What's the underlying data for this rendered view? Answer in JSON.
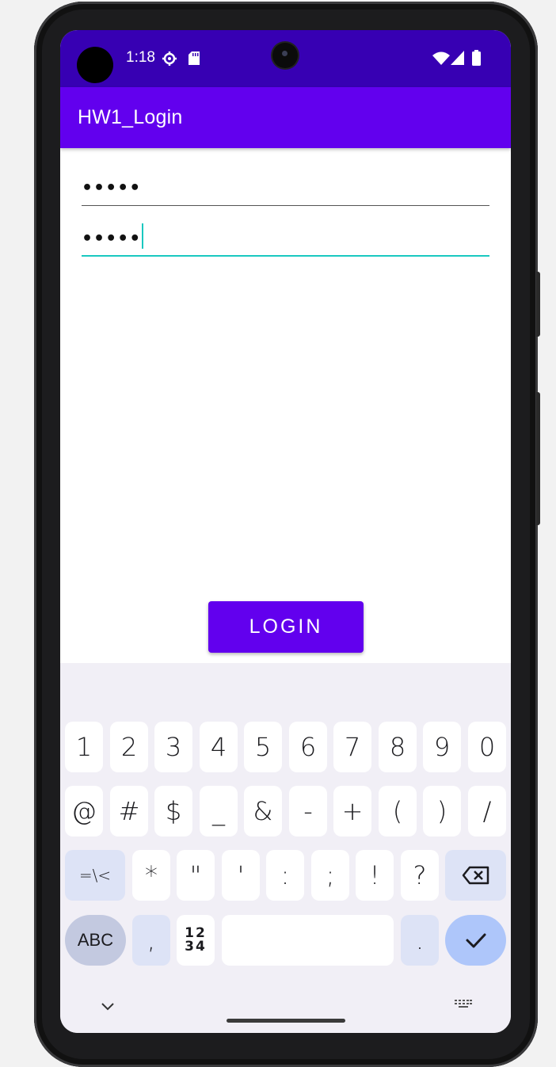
{
  "status_bar": {
    "time": "1:18"
  },
  "app_bar": {
    "title": "HW1_Login"
  },
  "form": {
    "username_value": "•••••",
    "password_value": "•••••",
    "login_label": "LOGIN"
  },
  "keyboard": {
    "row1": [
      "1",
      "2",
      "3",
      "4",
      "5",
      "6",
      "7",
      "8",
      "9",
      "0"
    ],
    "row2": [
      "@",
      "#",
      "$",
      "_",
      "&",
      "-",
      "+",
      "(",
      ")",
      "/"
    ],
    "row3": [
      "=\\<",
      "*",
      "\"",
      "'",
      ":",
      ";",
      "!",
      "?"
    ],
    "row4": {
      "abc": "ABC",
      "comma": ",",
      "num_top": "12",
      "num_bottom": "34",
      "period": "."
    }
  },
  "colors": {
    "status_bar": "#3700b3",
    "app_bar": "#6200ee",
    "accent": "#1ac8c0"
  }
}
